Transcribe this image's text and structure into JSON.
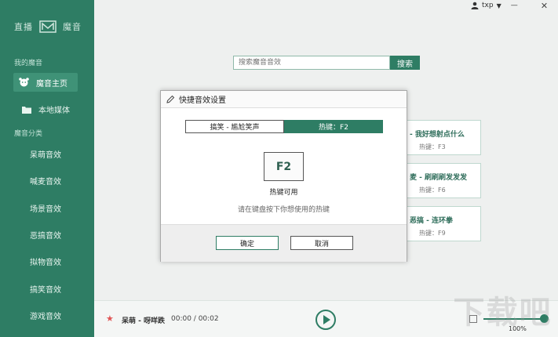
{
  "brand": {
    "left": "直播",
    "right": "魔音"
  },
  "sidebar": {
    "section_mine": "我的魔音",
    "home": "魔音主页",
    "local": "本地媒体",
    "section_categories": "魔音分类",
    "categories": [
      "呆萌音效",
      "喊麦音效",
      "场景音效",
      "恶搞音效",
      "拟物音效",
      "搞笑音效",
      "游戏音效"
    ]
  },
  "topbar": {
    "user": "txp",
    "close": "✕"
  },
  "search": {
    "placeholder": "搜索魔音音效",
    "button": "搜索"
  },
  "cards": [
    {
      "title": "- 我好想射点什么",
      "hotkey": "热键：F3"
    },
    {
      "title": "麦 - 刷刷刷发发发",
      "hotkey": "热键：F6"
    },
    {
      "title": "恶搞 - 连环拳",
      "hotkey": "热键：F9"
    }
  ],
  "dialog": {
    "title": "快捷音效设置",
    "sound_name": "搞笑 - 尴尬笑声",
    "hotkey_label": "热键：F2",
    "key": "F2",
    "status": "热键可用",
    "hint": "请在键盘按下你想使用的热键",
    "ok": "确定",
    "cancel": "取消"
  },
  "player": {
    "song": "呆萌 - 呀咩跌",
    "time": "00:00 / 00:02",
    "volume_label": "100%",
    "volume": 1.0
  },
  "watermark": "下载吧",
  "colors": {
    "accent": "#2e7d64",
    "sidebar": "#2e7d64",
    "star": "#e05454"
  }
}
